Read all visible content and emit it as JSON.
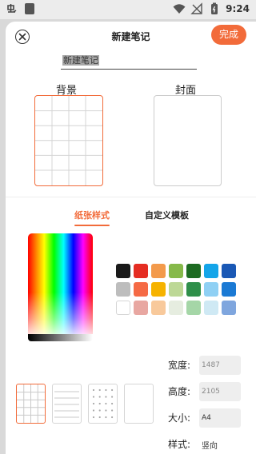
{
  "status": {
    "time": "9:24",
    "left_icons": [
      "notification-app-icon",
      "sim-card-icon"
    ],
    "right_icons": [
      "wifi-icon",
      "no-signal-icon",
      "battery-icon"
    ]
  },
  "header": {
    "title": "新建笔记",
    "close_icon": "close-circle-icon",
    "done_label": "完成"
  },
  "note_name": {
    "value": "新建笔记"
  },
  "previews": {
    "background_label": "背景",
    "cover_label": "封面"
  },
  "tabs": [
    {
      "label": "纸张样式",
      "selected": true
    },
    {
      "label": "自定义模板",
      "selected": false
    }
  ],
  "palette": {
    "colors": [
      "#1a1a1a",
      "#e52d22",
      "#f39a4b",
      "#86b94a",
      "#1d6b22",
      "#14a5e9",
      "#1a58b5",
      "#bdbdbd",
      "#f56a45",
      "#f6b300",
      "#bdd896",
      "#2f8f4a",
      "#8fd0f4",
      "#1b7ad4",
      "#ffffff",
      "#e8a7a1",
      "#f8c99b",
      "#e6ede0",
      "#a5d6a7",
      "#cfe9f4",
      "#7fa6de"
    ],
    "accent": "#f26b3a"
  },
  "settings": {
    "width_label": "宽度:",
    "width_value": "1487",
    "height_label": "高度:",
    "height_value": "2105",
    "size_label": "大小:",
    "size_value": "A4",
    "style_label": "样式:",
    "style_value": "竖向"
  },
  "paper_styles": [
    {
      "name": "grid",
      "selected": true
    },
    {
      "name": "lined",
      "selected": false
    },
    {
      "name": "dotted",
      "selected": false
    },
    {
      "name": "blank",
      "selected": false
    }
  ]
}
